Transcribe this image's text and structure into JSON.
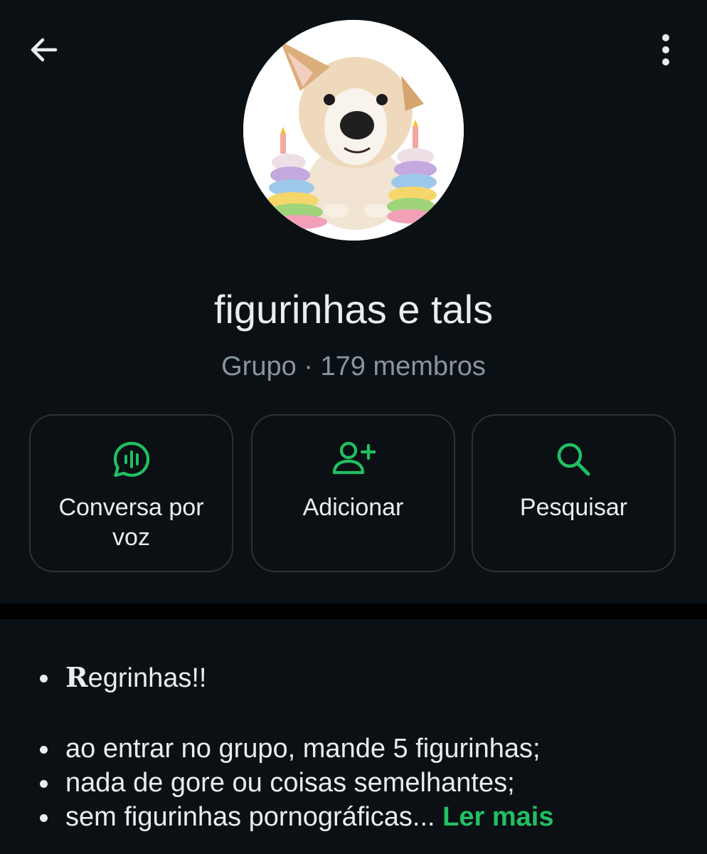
{
  "header": {
    "back_icon": "arrow-left-icon",
    "menu_icon": "vertical-dots-icon"
  },
  "profile": {
    "avatar_alt": "puppy-with-cake-photo",
    "name": "figurinhas e tals",
    "type_label": "Grupo",
    "separator": "·",
    "members": "179 membros"
  },
  "actions": [
    {
      "icon": "voice-chat-icon",
      "label": "Conversa por voz"
    },
    {
      "icon": "add-person-icon",
      "label": "Adicionar"
    },
    {
      "icon": "search-icon",
      "label": "Pesquisar"
    }
  ],
  "description": {
    "first_line_initial": "R",
    "first_line_rest": "egrinhas!!",
    "rules": [
      "ao entrar no grupo, mande 5 figurinhas;",
      "nada de gore ou coisas semelhantes;",
      "sem figurinhas pornográficas..."
    ],
    "read_more": "Ler mais"
  },
  "colors": {
    "background": "#0b1014",
    "accent": "#21c063",
    "text_primary": "#e9edef",
    "text_secondary": "#8696a0",
    "card_border": "#2a3238"
  }
}
